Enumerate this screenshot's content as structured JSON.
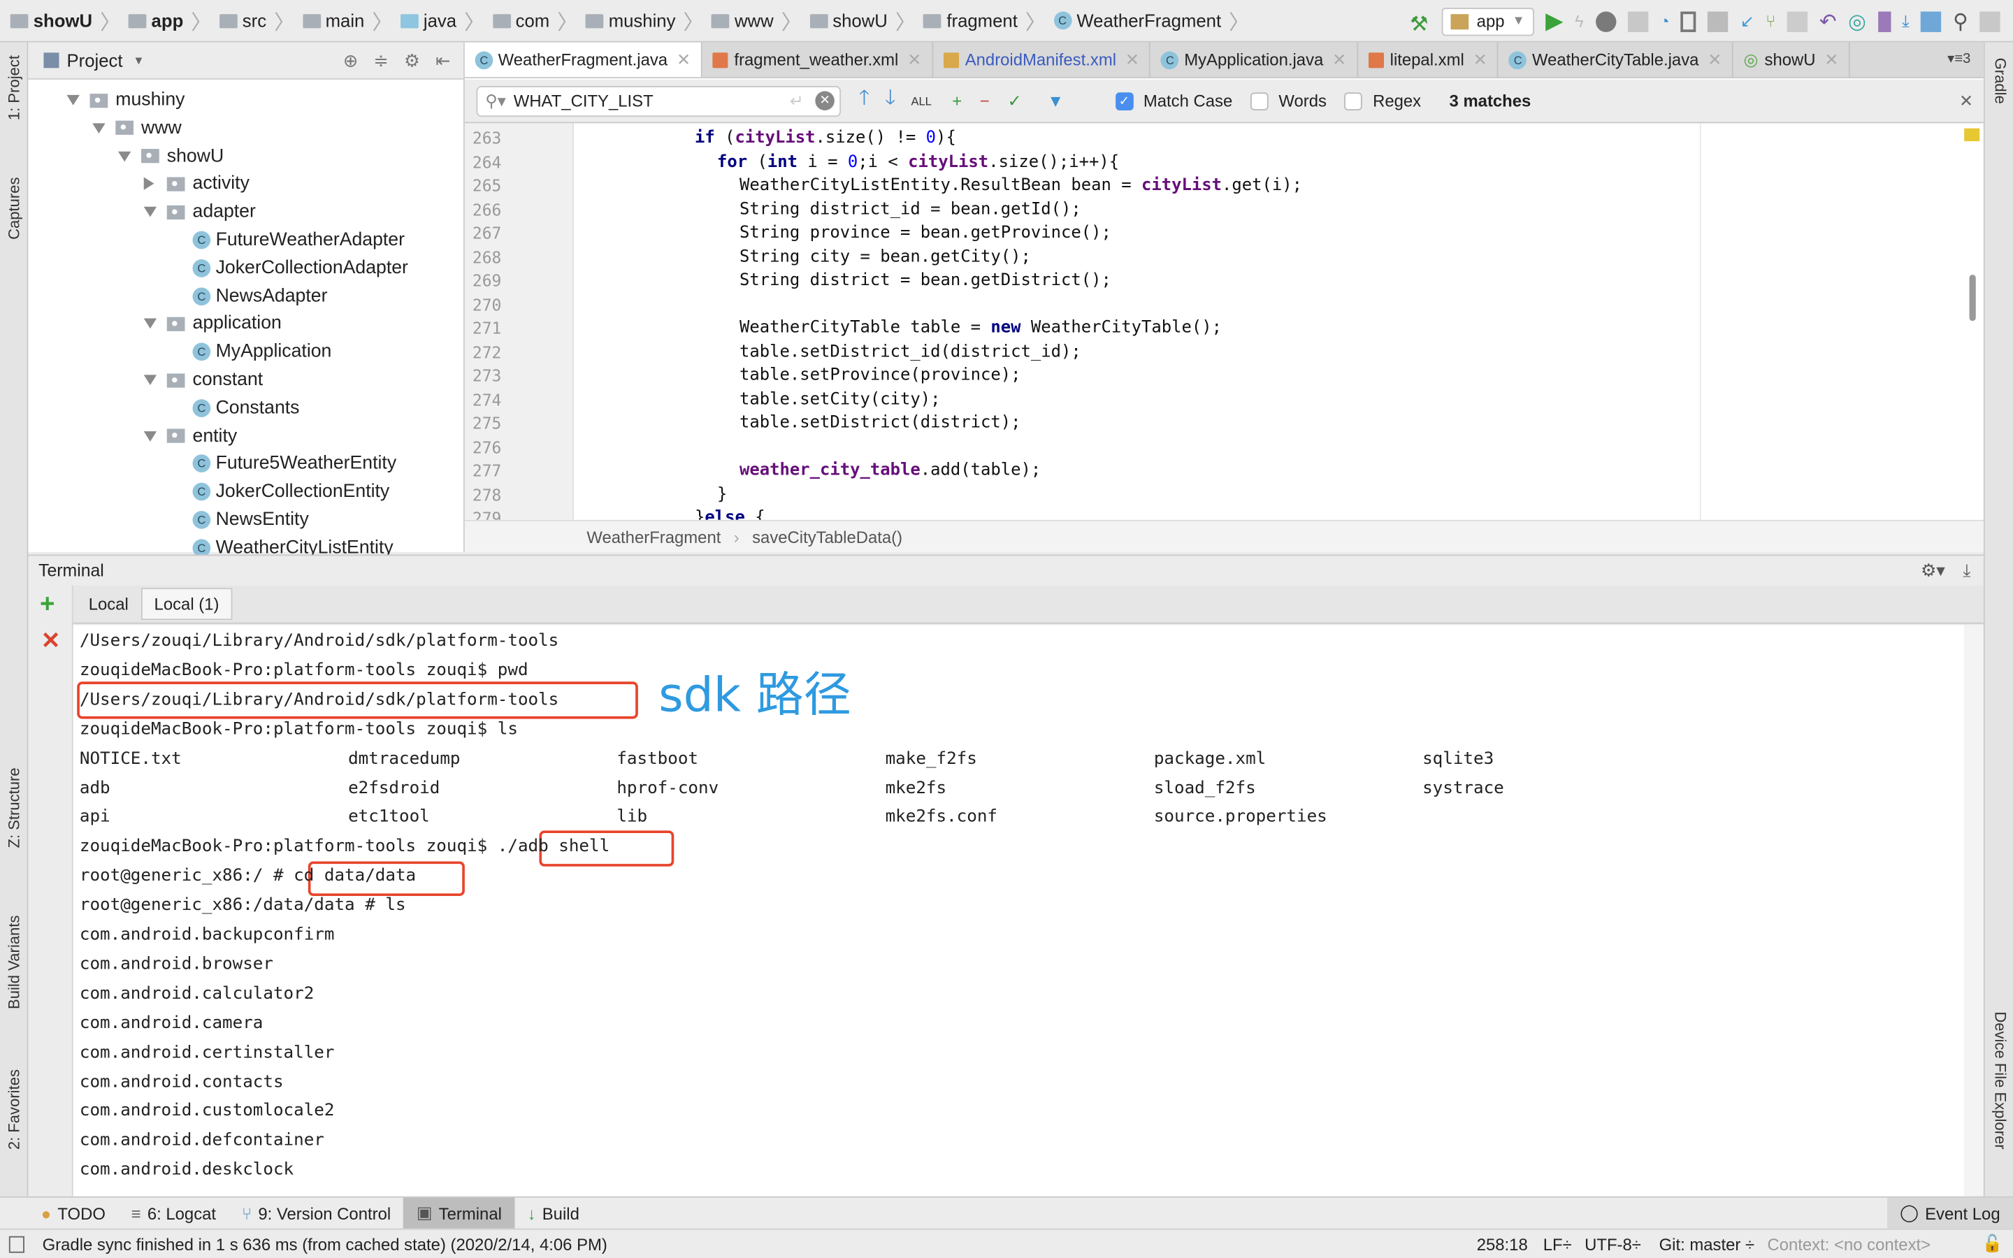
{
  "breadcrumb": [
    "showU",
    "app",
    "src",
    "main",
    "java",
    "com",
    "mushiny",
    "www",
    "showU",
    "fragment",
    "WeatherFragment"
  ],
  "toolbar": {
    "run_config": "app"
  },
  "left_strip": {
    "project": "1: Project",
    "captures": "Captures",
    "structure": "Z: Structure",
    "build_variants": "Build Variants",
    "favorites": "2: Favorites"
  },
  "right_strip": {
    "gradle": "Gradle",
    "device_file_explorer": "Device File Explorer"
  },
  "project_panel": {
    "title": "Project",
    "tree": [
      {
        "label": "mushiny",
        "type": "package",
        "expanded": true
      },
      {
        "label": "www",
        "type": "package",
        "expanded": true
      },
      {
        "label": "showU",
        "type": "package",
        "expanded": true
      },
      {
        "label": "activity",
        "type": "folder",
        "expanded": false
      },
      {
        "label": "adapter",
        "type": "folder",
        "expanded": true
      },
      {
        "label": "FutureWeatherAdapter",
        "type": "class"
      },
      {
        "label": "JokerCollectionAdapter",
        "type": "class"
      },
      {
        "label": "NewsAdapter",
        "type": "class"
      },
      {
        "label": "application",
        "type": "folder",
        "expanded": true
      },
      {
        "label": "MyApplication",
        "type": "class"
      },
      {
        "label": "constant",
        "type": "folder",
        "expanded": true
      },
      {
        "label": "Constants",
        "type": "class"
      },
      {
        "label": "entity",
        "type": "folder",
        "expanded": true
      },
      {
        "label": "Future5WeatherEntity",
        "type": "class"
      },
      {
        "label": "JokerCollectionEntity",
        "type": "class"
      },
      {
        "label": "NewsEntity",
        "type": "class"
      },
      {
        "label": "WeatherCityListEntity",
        "type": "class"
      }
    ]
  },
  "editor_tabs": [
    {
      "label": "WeatherFragment.java",
      "icon": "class",
      "active": true
    },
    {
      "label": "fragment_weather.xml",
      "icon": "xml"
    },
    {
      "label": "AndroidManifest.xml",
      "icon": "manifest",
      "color": "#3a5bbf"
    },
    {
      "label": "MyApplication.java",
      "icon": "class"
    },
    {
      "label": "litepal.xml",
      "icon": "xml"
    },
    {
      "label": "WeatherCityTable.java",
      "icon": "class"
    },
    {
      "label": "showU",
      "icon": "gradle"
    }
  ],
  "tabs_overflow": "3",
  "search": {
    "query": "WHAT_CITY_LIST",
    "match_case": "Match Case",
    "words": "Words",
    "regex": "Regex",
    "match_case_checked": true,
    "words_checked": false,
    "regex_checked": false,
    "matches": "3 matches"
  },
  "code": {
    "lines": [
      {
        "n": "263",
        "html": "<span class='kw'>if</span> (<span class='fld'>cityList</span>.size() != <span class='num'>0</span>){",
        "indent": 6
      },
      {
        "n": "264",
        "html": "<span class='kw'>for</span> (<span class='kw'>int</span> i = <span class='num'>0</span>;i &lt; <span class='fld'>cityList</span>.size();i++){",
        "indent": 8
      },
      {
        "n": "265",
        "html": "WeatherCityListEntity.ResultBean bean = <span class='fld'>cityList</span>.get(i);",
        "indent": 10
      },
      {
        "n": "266",
        "html": "String district_id = bean.getId();",
        "indent": 10
      },
      {
        "n": "267",
        "html": "String province = bean.getProvince();",
        "indent": 10
      },
      {
        "n": "268",
        "html": "String city = bean.getCity();",
        "indent": 10
      },
      {
        "n": "269",
        "html": "String district = bean.getDistrict();",
        "indent": 10
      },
      {
        "n": "270",
        "html": "",
        "indent": 10
      },
      {
        "n": "271",
        "html": "WeatherCityTable table = <span class='kw'>new</span> WeatherCityTable();",
        "indent": 10
      },
      {
        "n": "272",
        "html": "table.setDistrict_id(district_id);",
        "indent": 10
      },
      {
        "n": "273",
        "html": "table.setProvince(province);",
        "indent": 10
      },
      {
        "n": "274",
        "html": "table.setCity(city);",
        "indent": 10
      },
      {
        "n": "275",
        "html": "table.setDistrict(district);",
        "indent": 10
      },
      {
        "n": "276",
        "html": "",
        "indent": 10
      },
      {
        "n": "277",
        "html": "<span class='fld'>weather_city_table</span>.add(table);",
        "indent": 10
      },
      {
        "n": "278",
        "html": "}",
        "indent": 8
      },
      {
        "n": "279",
        "html": "}<span class='kw'>else</span> {",
        "indent": 6
      }
    ]
  },
  "editor_breadcrumb": [
    "WeatherFragment",
    "saveCityTableData()"
  ],
  "terminal": {
    "title": "Terminal",
    "tabs": [
      "Local",
      "Local (1)"
    ],
    "active_tab": 1,
    "lines": [
      "/Users/zouqi/Library/Android/sdk/platform-tools",
      "zouqideMacBook-Pro:platform-tools zouqi$ pwd",
      "/Users/zouqi/Library/Android/sdk/platform-tools",
      "zouqideMacBook-Pro:platform-tools zouqi$ ls",
      null,
      null,
      null,
      "zouqideMacBook-Pro:platform-tools zouqi$ ./adb shell",
      "root@generic_x86:/ # cd data/data",
      "root@generic_x86:/data/data # ls",
      "com.android.backupconfirm",
      "com.android.browser",
      "com.android.calculator2",
      "com.android.camera",
      "com.android.certinstaller",
      "com.android.contacts",
      "com.android.customlocale2",
      "com.android.defcontainer",
      "com.android.deskclock"
    ],
    "ls_rows": [
      [
        "NOTICE.txt",
        "dmtracedump",
        "fastboot",
        "make_f2fs",
        "package.xml",
        "sqlite3"
      ],
      [
        "adb",
        "e2fsdroid",
        "hprof-conv",
        "mke2fs",
        "sload_f2fs",
        "systrace"
      ],
      [
        "api",
        "etc1tool",
        "lib",
        "mke2fs.conf",
        "source.properties",
        ""
      ]
    ],
    "annotation": "sdk 路径",
    "highlight_color": "#e8452c",
    "annotation_color": "#2e9ae0"
  },
  "bottom_tools": [
    {
      "label": "TODO"
    },
    {
      "label": "6: Logcat"
    },
    {
      "label": "9: Version Control"
    },
    {
      "label": "Terminal",
      "active": true
    },
    {
      "label": "Build"
    }
  ],
  "event_log": "Event Log",
  "status": {
    "message": "Gradle sync finished in 1 s 636 ms (from cached state) (2020/2/14, 4:06 PM)",
    "position": "258:18",
    "line_sep": "LF÷",
    "encoding": "UTF-8÷",
    "git": "Git: master ÷",
    "context": "Context: <no context>"
  }
}
